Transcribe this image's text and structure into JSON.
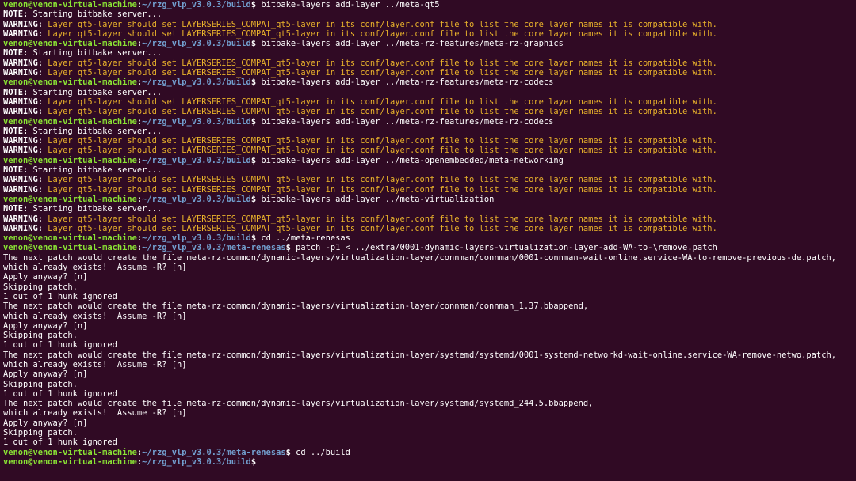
{
  "colors": {
    "background": "#300a24",
    "prompt_user": "#8ae234",
    "prompt_path": "#729fcf",
    "warning_text": "#e9b22b",
    "text": "#ffffff"
  },
  "lines": [
    {
      "type": "prompt",
      "user": "venon@venon-virtual-machine",
      "sep": ":",
      "path": "~/rzg_vlp_v3.0.3/build",
      "sym": "$",
      "cmd": " bitbake-layers add-layer ../meta-qt5"
    },
    {
      "type": "note",
      "label": "NOTE:",
      "text": " Starting bitbake server..."
    },
    {
      "type": "warning",
      "label": "WARNING:",
      "text": " Layer qt5-layer should set LAYERSERIES_COMPAT_qt5-layer in its conf/layer.conf file to list the core layer names it is compatible with."
    },
    {
      "type": "warning",
      "label": "WARNING:",
      "text": " Layer qt5-layer should set LAYERSERIES_COMPAT_qt5-layer in its conf/layer.conf file to list the core layer names it is compatible with."
    },
    {
      "type": "prompt",
      "user": "venon@venon-virtual-machine",
      "sep": ":",
      "path": "~/rzg_vlp_v3.0.3/build",
      "sym": "$",
      "cmd": " bitbake-layers add-layer ../meta-rz-features/meta-rz-graphics"
    },
    {
      "type": "note",
      "label": "NOTE:",
      "text": " Starting bitbake server..."
    },
    {
      "type": "warning",
      "label": "WARNING:",
      "text": " Layer qt5-layer should set LAYERSERIES_COMPAT_qt5-layer in its conf/layer.conf file to list the core layer names it is compatible with."
    },
    {
      "type": "warning",
      "label": "WARNING:",
      "text": " Layer qt5-layer should set LAYERSERIES_COMPAT_qt5-layer in its conf/layer.conf file to list the core layer names it is compatible with."
    },
    {
      "type": "prompt",
      "user": "venon@venon-virtual-machine",
      "sep": ":",
      "path": "~/rzg_vlp_v3.0.3/build",
      "sym": "$",
      "cmd": " bitbake-layers add-layer ../meta-rz-features/meta-rz-codecs"
    },
    {
      "type": "note",
      "label": "NOTE:",
      "text": " Starting bitbake server..."
    },
    {
      "type": "warning",
      "label": "WARNING:",
      "text": " Layer qt5-layer should set LAYERSERIES_COMPAT_qt5-layer in its conf/layer.conf file to list the core layer names it is compatible with."
    },
    {
      "type": "warning",
      "label": "WARNING:",
      "text": " Layer qt5-layer should set LAYERSERIES_COMPAT_qt5-layer in its conf/layer.conf file to list the core layer names it is compatible with."
    },
    {
      "type": "prompt",
      "user": "venon@venon-virtual-machine",
      "sep": ":",
      "path": "~/rzg_vlp_v3.0.3/build",
      "sym": "$",
      "cmd": " bitbake-layers add-layer ../meta-rz-features/meta-rz-codecs"
    },
    {
      "type": "note",
      "label": "NOTE:",
      "text": " Starting bitbake server..."
    },
    {
      "type": "warning",
      "label": "WARNING:",
      "text": " Layer qt5-layer should set LAYERSERIES_COMPAT_qt5-layer in its conf/layer.conf file to list the core layer names it is compatible with."
    },
    {
      "type": "warning",
      "label": "WARNING:",
      "text": " Layer qt5-layer should set LAYERSERIES_COMPAT_qt5-layer in its conf/layer.conf file to list the core layer names it is compatible with."
    },
    {
      "type": "prompt",
      "user": "venon@venon-virtual-machine",
      "sep": ":",
      "path": "~/rzg_vlp_v3.0.3/build",
      "sym": "$",
      "cmd": " bitbake-layers add-layer ../meta-openembedded/meta-networking"
    },
    {
      "type": "note",
      "label": "NOTE:",
      "text": " Starting bitbake server..."
    },
    {
      "type": "warning",
      "label": "WARNING:",
      "text": " Layer qt5-layer should set LAYERSERIES_COMPAT_qt5-layer in its conf/layer.conf file to list the core layer names it is compatible with."
    },
    {
      "type": "warning",
      "label": "WARNING:",
      "text": " Layer qt5-layer should set LAYERSERIES_COMPAT_qt5-layer in its conf/layer.conf file to list the core layer names it is compatible with."
    },
    {
      "type": "prompt",
      "user": "venon@venon-virtual-machine",
      "sep": ":",
      "path": "~/rzg_vlp_v3.0.3/build",
      "sym": "$",
      "cmd": " bitbake-layers add-layer ../meta-virtualization"
    },
    {
      "type": "note",
      "label": "NOTE:",
      "text": " Starting bitbake server..."
    },
    {
      "type": "warning",
      "label": "WARNING:",
      "text": " Layer qt5-layer should set LAYERSERIES_COMPAT_qt5-layer in its conf/layer.conf file to list the core layer names it is compatible with."
    },
    {
      "type": "warning",
      "label": "WARNING:",
      "text": " Layer qt5-layer should set LAYERSERIES_COMPAT_qt5-layer in its conf/layer.conf file to list the core layer names it is compatible with."
    },
    {
      "type": "prompt",
      "user": "venon@venon-virtual-machine",
      "sep": ":",
      "path": "~/rzg_vlp_v3.0.3/build",
      "sym": "$",
      "cmd": " cd ../meta-renesas"
    },
    {
      "type": "prompt",
      "user": "venon@venon-virtual-machine",
      "sep": ":",
      "path": "~/rzg_vlp_v3.0.3/meta-renesas",
      "sym": "$",
      "cmd": " patch -p1 < ../extra/0001-dynamic-layers-virtualization-layer-add-WA-to-\\remove.patch"
    },
    {
      "type": "output",
      "text": "The next patch would create the file meta-rz-common/dynamic-layers/virtualization-layer/connman/connman/0001-connman-wait-online.service-WA-to-remove-previous-de.patch,"
    },
    {
      "type": "output",
      "text": "which already exists!  Assume -R? [n]"
    },
    {
      "type": "output",
      "text": "Apply anyway? [n]"
    },
    {
      "type": "output",
      "text": "Skipping patch."
    },
    {
      "type": "output",
      "text": "1 out of 1 hunk ignored"
    },
    {
      "type": "output",
      "text": "The next patch would create the file meta-rz-common/dynamic-layers/virtualization-layer/connman/connman_1.37.bbappend,"
    },
    {
      "type": "output",
      "text": "which already exists!  Assume -R? [n]"
    },
    {
      "type": "output",
      "text": "Apply anyway? [n]"
    },
    {
      "type": "output",
      "text": "Skipping patch."
    },
    {
      "type": "output",
      "text": "1 out of 1 hunk ignored"
    },
    {
      "type": "output",
      "text": "The next patch would create the file meta-rz-common/dynamic-layers/virtualization-layer/systemd/systemd/0001-systemd-networkd-wait-online.service-WA-remove-netwo.patch,"
    },
    {
      "type": "output",
      "text": "which already exists!  Assume -R? [n]"
    },
    {
      "type": "output",
      "text": "Apply anyway? [n]"
    },
    {
      "type": "output",
      "text": "Skipping patch."
    },
    {
      "type": "output",
      "text": "1 out of 1 hunk ignored"
    },
    {
      "type": "output",
      "text": "The next patch would create the file meta-rz-common/dynamic-layers/virtualization-layer/systemd/systemd_244.5.bbappend,"
    },
    {
      "type": "output",
      "text": "which already exists!  Assume -R? [n]"
    },
    {
      "type": "output",
      "text": "Apply anyway? [n]"
    },
    {
      "type": "output",
      "text": "Skipping patch."
    },
    {
      "type": "output",
      "text": "1 out of 1 hunk ignored"
    },
    {
      "type": "prompt",
      "user": "venon@venon-virtual-machine",
      "sep": ":",
      "path": "~/rzg_vlp_v3.0.3/meta-renesas",
      "sym": "$",
      "cmd": " cd ../build"
    },
    {
      "type": "prompt",
      "user": "venon@venon-virtual-machine",
      "sep": ":",
      "path": "~/rzg_vlp_v3.0.3/build",
      "sym": "$",
      "cmd": ""
    }
  ]
}
